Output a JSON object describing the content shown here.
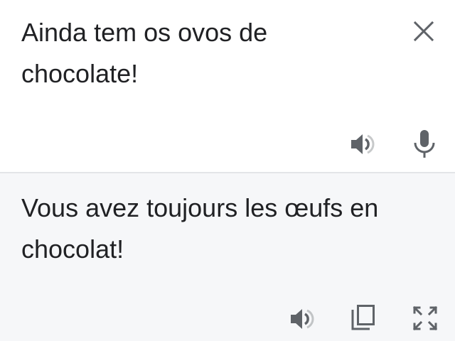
{
  "source": {
    "text": "Ainda tem os ovos de chocolate!",
    "icons": {
      "close": "close-icon",
      "listen": "speaker-icon",
      "voice_input": "microphone-icon"
    }
  },
  "translation": {
    "text": "Vous avez toujours les œufs en chocolat!",
    "icons": {
      "listen": "speaker-icon",
      "copy": "copy-icon",
      "fullscreen": "fullscreen-icon"
    }
  },
  "colors": {
    "text": "#202124",
    "icon": "#5f6368",
    "source_background": "#ffffff",
    "translation_background": "#f6f7f9",
    "divider": "#e3e5e8"
  }
}
